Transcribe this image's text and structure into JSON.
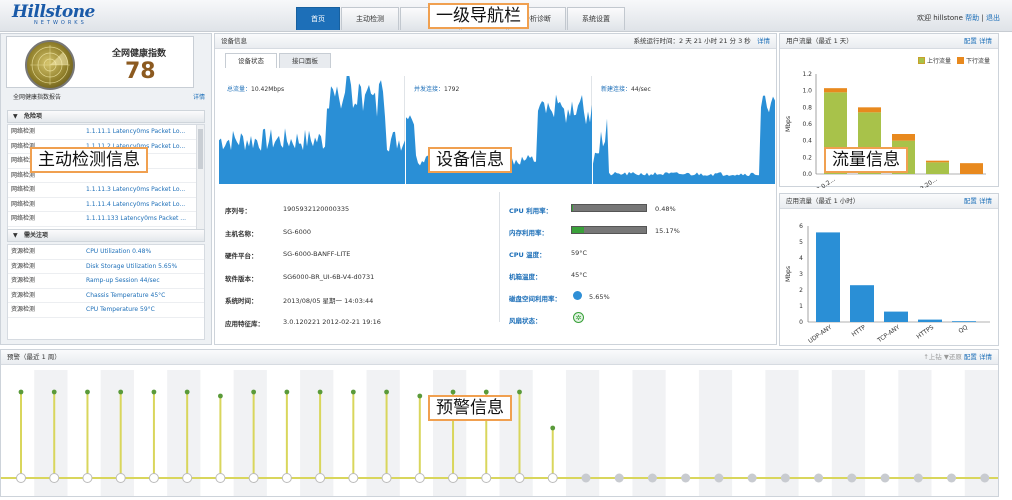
{
  "app": {
    "brand": "Hillstone",
    "brand_sub": "NETWORKS"
  },
  "nav": {
    "tabs": [
      {
        "label": "首页",
        "active": true
      },
      {
        "label": "主动检测",
        "active": false
      },
      {
        "label": "",
        "active": false
      },
      {
        "label": "",
        "active": false
      },
      {
        "label": "分析诊断",
        "active": false
      },
      {
        "label": "系统设置",
        "active": false
      }
    ]
  },
  "user": {
    "greeting": "欢迎 hillstone",
    "help": "帮助",
    "separator": "|",
    "logout": "退出"
  },
  "health": {
    "title": "全网健康指数",
    "score": "78",
    "report_label": "全网健康指数报告",
    "report_link": "详情"
  },
  "dangerous": {
    "title": "危险项",
    "rows": [
      {
        "type": "网络检测",
        "text": "1.1.11.1  Latency0ms Packet Lo..."
      },
      {
        "type": "网络检测",
        "text": "1.1.11.2  Latency0ms Packet Lo..."
      },
      {
        "type": "网络检测",
        "text": ""
      },
      {
        "type": "网络检测",
        "text": ""
      },
      {
        "type": "网络检测",
        "text": "1.1.11.3  Latency0ms Packet Lo..."
      },
      {
        "type": "网络检测",
        "text": "1.1.11.4  Latency0ms Packet Lo..."
      },
      {
        "type": "网络检测",
        "text": "1.1.11.133  Latency0ms Packet ..."
      },
      {
        "type": "网络检测",
        "text": "1.1.11.177  Latency0ms Packet ..."
      }
    ]
  },
  "watch": {
    "title": "需关注项",
    "rows": [
      {
        "type": "资源检测",
        "text": "CPU Utilization  0.48%"
      },
      {
        "type": "资源检测",
        "text": "Disk Storage Utilization  5.65%"
      },
      {
        "type": "资源检测",
        "text": "Ramp-up Session  44/sec"
      },
      {
        "type": "资源检测",
        "text": "Chassis Temperature  45°C"
      },
      {
        "type": "资源检测",
        "text": "CPU Temperature  59°C"
      }
    ]
  },
  "device": {
    "title": "设备信息",
    "uptime": "系统运行时间：2 天 21 小时 21 分 3 秒",
    "detail": "详情",
    "tabs": [
      {
        "label": "设备状态",
        "active": true
      },
      {
        "label": "接口面板",
        "active": false
      }
    ],
    "charts": [
      {
        "key": "总流量：",
        "value": "10.42Mbps"
      },
      {
        "key": "并发连接：",
        "value": "1792"
      },
      {
        "key": "新建连接：",
        "value": "44/sec"
      }
    ],
    "info": [
      {
        "k": "序列号：",
        "v": "1905932120000335"
      },
      {
        "k": "主机名称：",
        "v": "SG-6000"
      },
      {
        "k": "硬件平台：",
        "v": "SG-6000-BANFF-LITE"
      },
      {
        "k": "软件版本：",
        "v": "SG6000-BR_UI-6B-V4-d0731"
      },
      {
        "k": "系统时间：",
        "v": "2013/08/05 星期一 14:03:44"
      },
      {
        "k": "应用特征库：",
        "v": "3.0.120221 2012-02-21 19:16"
      }
    ],
    "stats": {
      "cpu": {
        "k": "CPU 利用率：",
        "v": "0.48%",
        "fraction": 0.02
      },
      "mem": {
        "k": "内存利用率：",
        "v": "15.17%",
        "fraction": 0.16
      },
      "cpu_temp": {
        "k": "CPU 温度：",
        "v": "59°C"
      },
      "chassis_temp": {
        "k": "机箱温度：",
        "v": "45°C"
      },
      "disk": {
        "k": "磁盘空间利用率：",
        "v": "5.65%"
      },
      "fan": {
        "k": "风扇状态："
      }
    }
  },
  "user_traffic": {
    "title": "用户流量（最近 1 天）",
    "config": "配置",
    "detail": "详情",
    "legend_up": "上行流量",
    "legend_down": "下行流量",
    "ylabel": "Mbps",
    "color_up": "#a8c24a",
    "color_down": "#e8891e"
  },
  "app_traffic": {
    "title": "应用流量（最近 1 小时）",
    "config": "配置",
    "detail": "详情",
    "ylabel": "Mbps",
    "bar_color": "#2a8fd6"
  },
  "warning": {
    "title": "预警（最近 1 周）",
    "toolbar": "↑上钻 ▼还原",
    "config": "配置",
    "detail": "详情"
  },
  "chart_data": [
    {
      "type": "bar",
      "title": "用户流量（最近 1 天）",
      "ylabel": "Mbps",
      "ylim": [
        0,
        1.2
      ],
      "yticks": [
        "0.0",
        "0.2",
        "0.4",
        "0.6",
        "0.8",
        "1.0",
        "1.2"
      ],
      "categories": [
        "10.23.0.2...",
        "",
        "",
        "113.20..."
      ],
      "series": [
        {
          "name": "上行流量",
          "values": [
            0.98,
            0.74,
            0.4,
            0.14
          ]
        },
        {
          "name": "下行流量",
          "values": [
            0.05,
            0.06,
            0.08,
            0.02
          ]
        }
      ],
      "extra_last_bar": 0.13
    },
    {
      "type": "bar",
      "title": "应用流量（最近 1 小时）",
      "ylabel": "Mbps",
      "ylim": [
        0,
        6
      ],
      "yticks": [
        "0",
        "1",
        "2",
        "3",
        "4",
        "5",
        "6"
      ],
      "categories": [
        "UDP-ANY",
        "HTTP",
        "TCP-ANY",
        "HTTPS",
        "QQ"
      ],
      "values": [
        5.6,
        2.3,
        0.65,
        0.15,
        0.05
      ]
    },
    {
      "type": "line",
      "title": "预警（最近 1 周）",
      "values": [
        1,
        1,
        1,
        1,
        1,
        1,
        1,
        1,
        1,
        1,
        1,
        1,
        1,
        1,
        1,
        1,
        0.6,
        0,
        0,
        0,
        0,
        0,
        0,
        0,
        0,
        0,
        0,
        0,
        0,
        0
      ],
      "second_level": [
        0,
        0,
        0,
        0,
        0,
        0,
        0.98,
        0,
        0,
        0,
        0,
        0,
        0.96,
        0,
        0,
        0,
        0,
        0,
        0,
        0,
        0,
        0,
        0,
        0,
        0,
        0,
        0,
        0,
        0,
        0
      ]
    }
  ],
  "callouts": {
    "nav": "一级导航栏",
    "detect": "主动检测信息",
    "device": "设备信息",
    "traffic": "流量信息",
    "warning": "预警信息"
  }
}
